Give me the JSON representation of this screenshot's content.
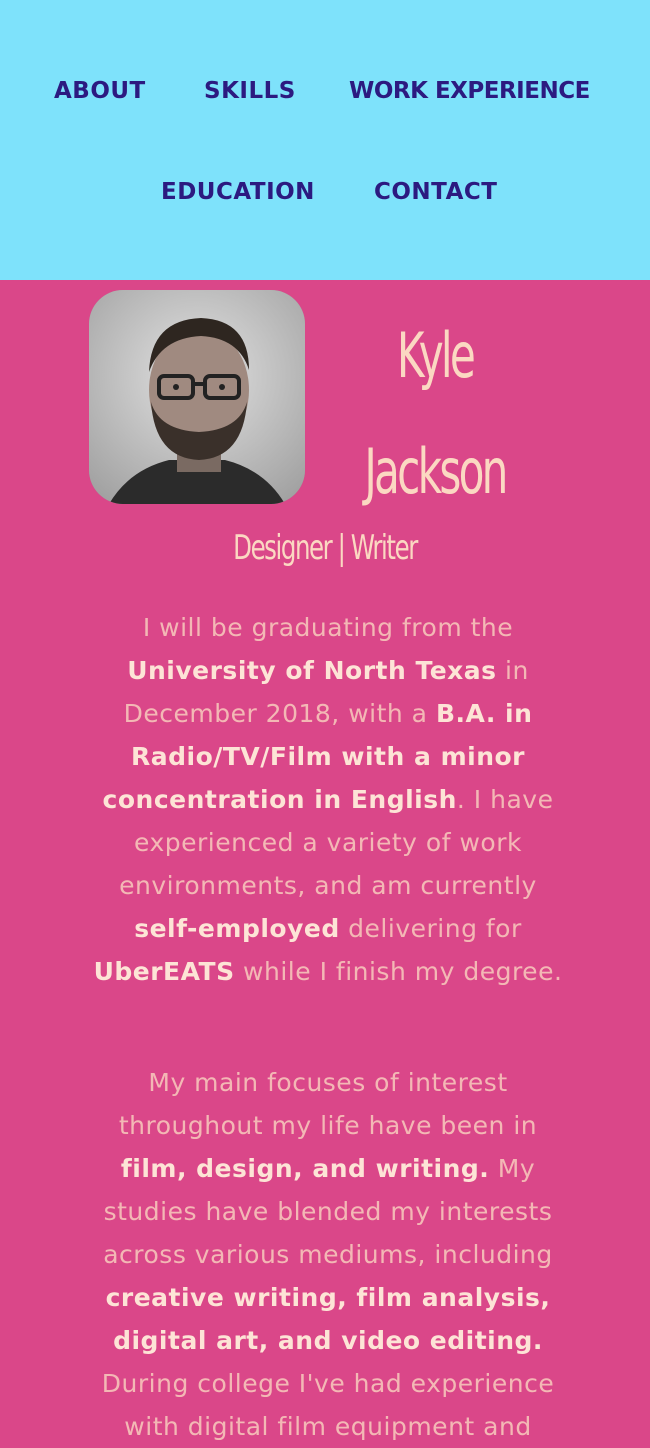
{
  "nav": {
    "items": [
      "ABOUT",
      "SKILLS",
      "WORK EXPERIENCE",
      "EDUCATION",
      "CONTACT"
    ]
  },
  "profile": {
    "first_name": "Kyle",
    "last_name": "Jackson",
    "subtitle": "Designer | Writer",
    "avatar": "portrait-photo"
  },
  "bio1": [
    {
      "t": "I will be graduating from the ",
      "b": false
    },
    {
      "t": "University of North Texas",
      "b": true
    },
    {
      "t": " in December 2018, with a ",
      "b": false
    },
    {
      "t": "B.A. in Radio/TV/Film with a minor concentration in English",
      "b": true
    },
    {
      "t": ". I have experienced a variety of work environments, and am currently ",
      "b": false
    },
    {
      "t": "self-employed",
      "b": true
    },
    {
      "t": " delivering for ",
      "b": false
    },
    {
      "t": "UberEATS",
      "b": true
    },
    {
      "t": " while I finish my degree.",
      "b": false
    }
  ],
  "bio2": [
    {
      "t": "My main focuses of interest throughout my life have been in ",
      "b": false
    },
    {
      "t": "film, design, and writing.",
      "b": true
    },
    {
      "t": " My studies have blended my interests across various mediums, including ",
      "b": false
    },
    {
      "t": "creative writing, film analysis, digital art, and video editing.",
      "b": true
    },
    {
      "t": " During college I've had experience with digital film equipment and",
      "b": false
    }
  ],
  "colors": {
    "nav_bg": "#7ee2fb",
    "nav_text": "#2c1a80",
    "page_bg": "#da4789",
    "text": "#fbd8c2"
  }
}
